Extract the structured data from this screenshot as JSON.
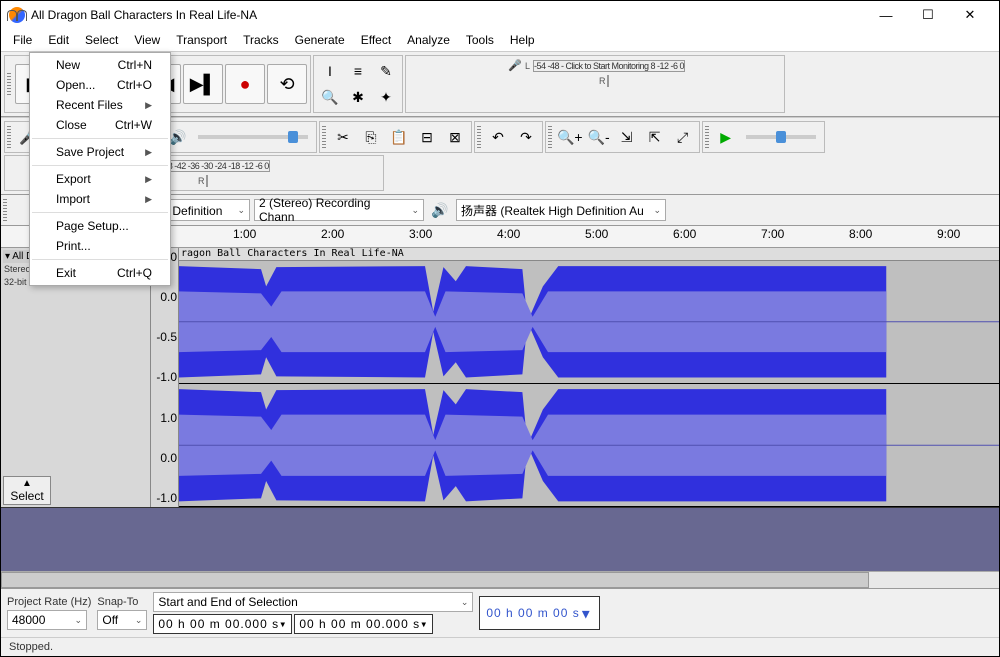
{
  "window": {
    "title": "All Dragon Ball Characters In Real Life-NA"
  },
  "menubar": [
    "File",
    "Edit",
    "Select",
    "View",
    "Transport",
    "Tracks",
    "Generate",
    "Effect",
    "Analyze",
    "Tools",
    "Help"
  ],
  "file_menu": [
    {
      "label": "New",
      "accel": "Ctrl+N"
    },
    {
      "label": "Open...",
      "accel": "Ctrl+O"
    },
    {
      "label": "Recent Files",
      "sub": true
    },
    {
      "label": "Close",
      "accel": "Ctrl+W"
    },
    {
      "sep": true
    },
    {
      "label": "Save Project",
      "sub": true
    },
    {
      "sep": true
    },
    {
      "label": "Export",
      "sub": true
    },
    {
      "label": "Import",
      "sub": true
    },
    {
      "sep": true
    },
    {
      "label": "Page Setup..."
    },
    {
      "label": "Print..."
    },
    {
      "sep": true
    },
    {
      "label": "Exit",
      "accel": "Ctrl+Q"
    }
  ],
  "meters": {
    "rec_ticks": "-54   -48   -   Click to Start Monitoring  8   -12   -6   0",
    "play_ticks": "-54   -48   -42   -36   -30   -24   -18   -12   -6   0"
  },
  "devices": {
    "host": "体声混音 (Realtek High Definition",
    "rec_input": "2 (Stereo) Recording Chann",
    "play_output": "扬声器 (Realtek High Definition Au"
  },
  "timeline_labels": [
    "1:00",
    "2:00",
    "3:00",
    "4:00",
    "5:00",
    "6:00",
    "7:00",
    "8:00",
    "9:00"
  ],
  "track": {
    "name": "ragon Ball Characters In Real Life-NA",
    "info1": "Stereo, 48000Hz",
    "info2": "32-bit float",
    "scale": [
      "1.0",
      "0.0",
      "-0.5",
      "-1.0",
      "1.0",
      "0.0",
      "-1.0"
    ],
    "select_btn": "Select"
  },
  "selection": {
    "rate_label": "Project Rate (Hz)",
    "rate_value": "48000",
    "snap_label": "Snap-To",
    "snap_value": "Off",
    "range_label": "Start and End of Selection",
    "start": "00 h 00 m 00.000 s",
    "end": "00 h 00 m 00.000 s",
    "position": "00 h 00 m 00 s"
  },
  "status": "Stopped."
}
